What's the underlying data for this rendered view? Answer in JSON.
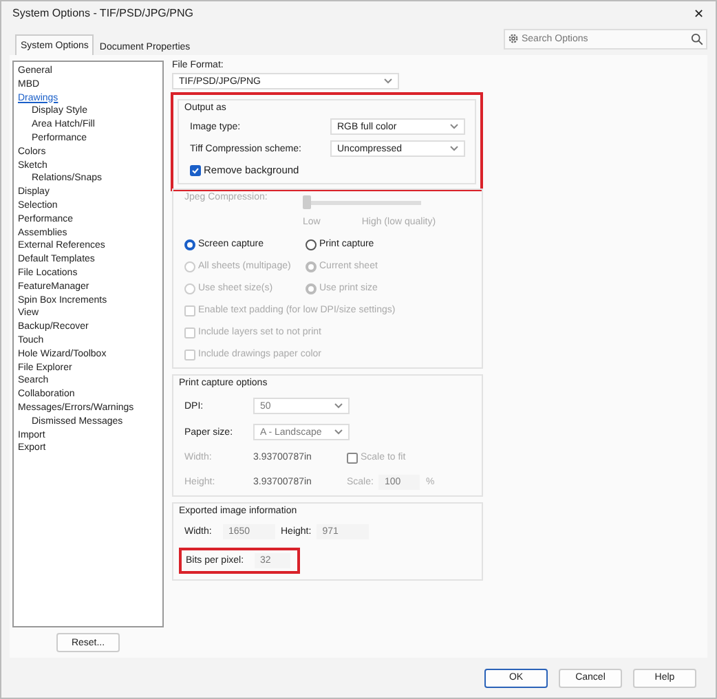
{
  "window": {
    "title": "System Options - TIF/PSD/JPG/PNG",
    "close": "✕"
  },
  "tabs": [
    {
      "label": "System Options",
      "selected": true
    },
    {
      "label": "Document Properties",
      "selected": false
    }
  ],
  "search": {
    "placeholder": "Search Options"
  },
  "tree": [
    {
      "label": "General",
      "selected": false
    },
    {
      "label": "MBD",
      "selected": false
    },
    {
      "label": "Drawings",
      "selected": true,
      "children": [
        {
          "label": "Display Style",
          "selected": false
        },
        {
          "label": "Area Hatch/Fill",
          "selected": false
        },
        {
          "label": "Performance",
          "selected": false
        }
      ]
    },
    {
      "label": "Colors",
      "selected": false
    },
    {
      "label": "Sketch",
      "selected": false,
      "children": [
        {
          "label": "Relations/Snaps",
          "selected": false
        }
      ]
    },
    {
      "label": "Display",
      "selected": false
    },
    {
      "label": "Selection",
      "selected": false
    },
    {
      "label": "Performance",
      "selected": false
    },
    {
      "label": "Assemblies",
      "selected": false
    },
    {
      "label": "External References",
      "selected": false
    },
    {
      "label": "Default Templates",
      "selected": false
    },
    {
      "label": "File Locations",
      "selected": false
    },
    {
      "label": "FeatureManager",
      "selected": false
    },
    {
      "label": "Spin Box Increments",
      "selected": false
    },
    {
      "label": "View",
      "selected": false
    },
    {
      "label": "Backup/Recover",
      "selected": false
    },
    {
      "label": "Touch",
      "selected": false
    },
    {
      "label": "Hole Wizard/Toolbox",
      "selected": false
    },
    {
      "label": "File Explorer",
      "selected": false
    },
    {
      "label": "Search",
      "selected": false
    },
    {
      "label": "Collaboration",
      "selected": false
    },
    {
      "label": "Messages/Errors/Warnings",
      "selected": false,
      "children": [
        {
          "label": "Dismissed Messages",
          "selected": false
        }
      ]
    },
    {
      "label": "Import",
      "selected": false
    },
    {
      "label": "Export",
      "selected": false
    }
  ],
  "reset_button": "Reset...",
  "file_format": {
    "label": "File Format:",
    "value": "TIF/PSD/JPG/PNG"
  },
  "output_as": {
    "title": "Output as",
    "highlighted": true,
    "fields": [
      {
        "label": "Image type:",
        "value": "RGB full color"
      },
      {
        "label": "Tiff Compression scheme:",
        "value": "Uncompressed"
      }
    ],
    "remove_background": {
      "label": "Remove background",
      "checked": true
    }
  },
  "jpeg": {
    "label": "Jpeg Compression:",
    "level": 0,
    "low": "Low",
    "high": "High (low quality)",
    "disabled": true
  },
  "capture": [
    {
      "label": "Screen capture",
      "selected": true,
      "disabled": false
    },
    {
      "label": "Print capture",
      "selected": false,
      "disabled": false
    },
    {
      "label": "All sheets (multipage)",
      "selected": false,
      "disabled": true
    },
    {
      "label": "Current sheet",
      "selected": true,
      "disabled": true
    },
    {
      "label": "Use sheet size(s)",
      "selected": false,
      "disabled": true
    },
    {
      "label": "Use print size",
      "selected": true,
      "disabled": true
    }
  ],
  "options": [
    {
      "label": "Enable text padding (for low DPI/size settings)",
      "checked": false,
      "disabled": true
    },
    {
      "label": "Include layers set to not print",
      "checked": false,
      "disabled": true
    },
    {
      "label": "Include drawings paper color",
      "checked": false,
      "disabled": true
    }
  ],
  "print_capture": {
    "title": "Print capture options",
    "dpi": {
      "label": "DPI:",
      "value": "50"
    },
    "paper": {
      "label": "Paper size:",
      "value": "A - Landscape"
    },
    "width": {
      "label": "Width:",
      "value": "3.93700787in"
    },
    "height": {
      "label": "Height:",
      "value": "3.93700787in"
    },
    "scale_to_fit": {
      "label": "Scale to fit",
      "checked": false
    },
    "scale": {
      "label": "Scale:",
      "value": "100",
      "unit": "%"
    }
  },
  "exported": {
    "title": "Exported image information",
    "width": {
      "label": "Width:",
      "value": "1650"
    },
    "height": {
      "label": "Height:",
      "value": "971"
    },
    "bits": {
      "label": "Bits per pixel:",
      "value": "32",
      "highlighted": true
    }
  },
  "buttons": [
    {
      "label": "OK",
      "default": true
    },
    {
      "label": "Cancel",
      "default": false
    },
    {
      "label": "Help",
      "default": false
    }
  ]
}
